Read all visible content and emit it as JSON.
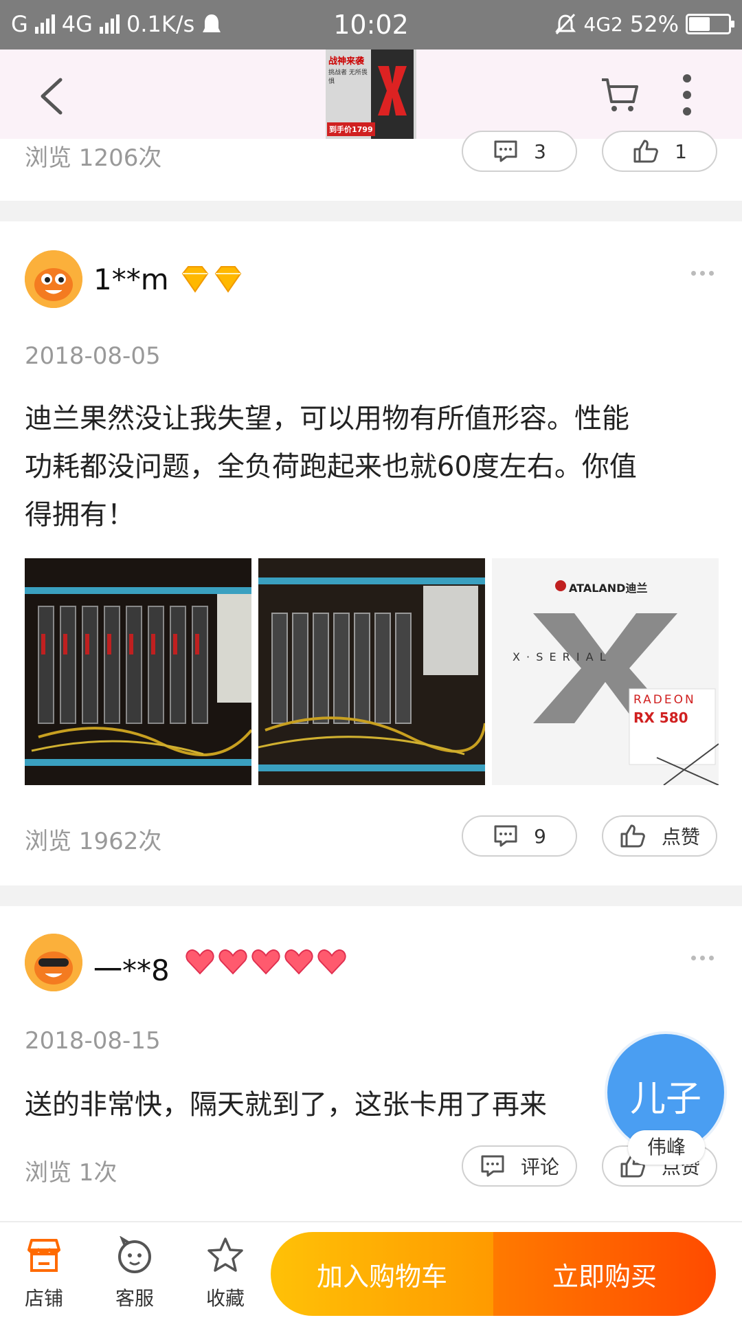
{
  "status_bar": {
    "carrier1": "G",
    "carrier2": "4G",
    "speed": "0.1K/s",
    "time": "10:02",
    "net_right": "4G2",
    "battery_text": "52%",
    "battery_level": 0.52
  },
  "header": {
    "thumbnail": {
      "title": "战神来袭",
      "subtitle": "挑战者 无所畏惧",
      "price": "到手价1799"
    }
  },
  "prev_item": {
    "views": "浏览 1206次",
    "comment_count": "3",
    "like_count": "1"
  },
  "reviews": [
    {
      "username": "1**m",
      "badge_count": 2,
      "date": "2018-08-05",
      "text": "迪兰果然没让我失望，可以用物有所值形容。性能功耗都没问题，全负荷跑起来也就60度左右。你值得拥有！",
      "text_lines": [
        "迪兰果然没让我失望，可以用物有所值形容。性能",
        "功耗都没问题，全负荷跑起来也就60度左右。你值",
        "得拥有！"
      ],
      "photos": {
        "box_brand": "ATALAND迪兰",
        "box_series": "X · S E R I A L",
        "box_line1": "RADEON",
        "box_line2": "RX 580"
      },
      "views": "浏览 1962次",
      "comment_count": "9",
      "like_label": "点赞"
    },
    {
      "username": "一**8",
      "badge_count": 5,
      "date": "2018-08-15",
      "text": "送的非常快，隔天就到了，这张卡用了再来",
      "views": "浏览 1次",
      "comment_label": "评论",
      "like_label": "点赞"
    }
  ],
  "floating_badge": {
    "title": "儿子",
    "tag": "伟峰"
  },
  "bottom_bar": {
    "shop_label": "店铺",
    "service_label": "客服",
    "favorite_label": "收藏",
    "add_to_cart_label": "加入购物车",
    "buy_now_label": "立即购买"
  },
  "colors": {
    "accent_orange": "#ff6a00",
    "cart_yellow": "#ffb400",
    "badge_blue": "#4a9ef2",
    "separator": "#f2f2f2"
  }
}
